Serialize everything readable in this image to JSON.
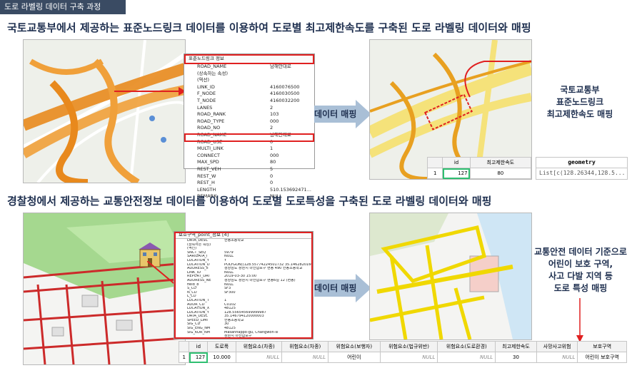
{
  "header": {
    "title": "도로 라벨링 데이터 구축 과정"
  },
  "section1": {
    "heading": "국토교통부에서 제공하는 표준노드링크 데이터를 이용하여 도로별 최고제한속도를 구축된 도로 라벨링 데이터와 매핑",
    "attr_title": "표준노드링크 정보",
    "attr_rows": [
      {
        "k": "ROAD_NAME",
        "v": "남해안대로"
      },
      {
        "k": "(상속하는 속성)",
        "v": ""
      },
      {
        "k": "(역선)",
        "v": ""
      },
      {
        "k": "LINK_ID",
        "v": "4160076500"
      },
      {
        "k": "F_NODE",
        "v": "4160030500"
      },
      {
        "k": "T_NODE",
        "v": "4160032200"
      },
      {
        "k": "LANES",
        "v": "2"
      },
      {
        "k": "ROAD_RANK",
        "v": "103"
      },
      {
        "k": "ROAD_TYPE",
        "v": "000"
      },
      {
        "k": "ROAD_NO",
        "v": "2"
      },
      {
        "k": "ROAD_NAME",
        "v": "남해안대로"
      },
      {
        "k": "ROAD_USE",
        "v": "0"
      },
      {
        "k": "MULTI_LINK",
        "v": "1"
      },
      {
        "k": "CONNECT",
        "v": "000"
      },
      {
        "k": "MAX_SPD",
        "v": "80"
      },
      {
        "k": "REST_VEH",
        "v": "5"
      },
      {
        "k": "REST_W",
        "v": "0"
      },
      {
        "k": "REST_H",
        "v": "0"
      },
      {
        "k": "LENGTH",
        "v": "510.153692471..."
      },
      {
        "k": "REMARK",
        "v": "NULL"
      }
    ],
    "arrow_label": "데이터 매핑",
    "note": "국토교통부\n표준노드링크\n최고제한속도 매핑",
    "table": {
      "headers": [
        "",
        "id",
        "최고제한속도"
      ],
      "row": [
        "1",
        "127",
        "80"
      ]
    },
    "geometry": {
      "header": "geometry",
      "value": "List[c(128.26344,128.5..."
    }
  },
  "section2": {
    "heading": "경찰청에서 제공하는 교통안전정보 데이터를 이용하여 도로별 도로특성을 구축된 도로 라벨링 데이터와 매핑",
    "attr_title": "보호구역_point_정보 [4]",
    "attr_rows": [
      {
        "k": "DATA_DESC",
        "v": "한동초등학교"
      },
      {
        "k": "(상속하는 속성)",
        "v": ""
      },
      {
        "k": "(역선)",
        "v": ""
      },
      {
        "k": "SNCT_SEQ",
        "v": "5979"
      },
      {
        "k": "SARIDATA_I",
        "v": "NULL"
      },
      {
        "k": "LOCATION_Y",
        "v": "Y"
      },
      {
        "k": "LOCATION_D",
        "v": "POLYGON((128.55774224501732 35.1462820160"
      },
      {
        "k": "ADDRESS_II",
        "v": "경상남도 창원시 마산합포구 현동 490 한동초등학교"
      },
      {
        "k": "LINK_ID",
        "v": "NULL"
      },
      {
        "k": "REPORT_DAT",
        "v": "2019-03-30 15:00"
      },
      {
        "k": "ADDRESS_NE",
        "v": "경상남도 창원시 마산합포구 현동6길 12 (현동)"
      },
      {
        "k": "field_8",
        "v": "NULL"
      },
      {
        "k": "S_CD",
        "v": "SF3"
      },
      {
        "k": "N_CD",
        "v": "SF300"
      },
      {
        "k": "L_CD",
        "v": ""
      },
      {
        "k": "LOCATION_T",
        "v": "1"
      },
      {
        "k": "ADDR_CD",
        "v": "C0102"
      },
      {
        "k": "LOCATION_X",
        "v": "48125"
      },
      {
        "k": "LOCATION_Y",
        "v": "128.556545699999987"
      },
      {
        "k": "DATA_DESC",
        "v": "35.146794120000003"
      },
      {
        "k": "SPEED_LIMI",
        "v": "한동초등학교"
      },
      {
        "k": "SIG_CD",
        "v": "30"
      },
      {
        "k": "SIG_ENG_NM",
        "v": "48125"
      },
      {
        "k": "SIG_KOR_NM",
        "v": "Masanhappo-gu, Changwon-si"
      },
      {
        "k": "",
        "v": "창원시 마산합포구"
      }
    ],
    "arrow_label": "데이터 매핑",
    "note": "교통안전 데이터 기준으로\n어린이 보호 구역,\n사고 다발 지역 등\n도로 특성 매핑",
    "table": {
      "headers": [
        "",
        "id",
        "도로폭",
        "위험요소(차종)",
        "위험요소(차종)",
        "위험요소(보행자)",
        "위험요소(법규위반)",
        "위험요소(도로환경)",
        "최고제한속도",
        "사망사고위험",
        "보호구역"
      ],
      "row": [
        "1",
        "127",
        "10.000",
        "NULL",
        "NULL",
        "어린이",
        "NULL",
        "NULL",
        "30",
        "NULL",
        "어린이 보호구역"
      ]
    }
  },
  "colors": {
    "accent": "#e02020",
    "title_bg": "#3a4b63",
    "arrow": "#a9bfd6",
    "highlight_green": "#2fbf71"
  }
}
